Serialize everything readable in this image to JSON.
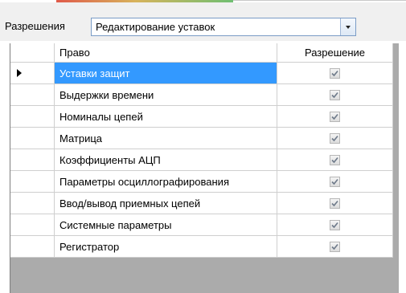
{
  "toolbar": {
    "permissions_label": "Разрешения",
    "combo_value": "Редактирование уставок"
  },
  "grid": {
    "columns": [
      "Право",
      "Разрешение"
    ],
    "rows": [
      {
        "label": "Уставки защит",
        "checked": true,
        "selected": true
      },
      {
        "label": "Выдержки времени",
        "checked": true
      },
      {
        "label": "Номиналы цепей",
        "checked": true
      },
      {
        "label": "Матрица",
        "checked": true
      },
      {
        "label": "Коэффициенты АЦП",
        "checked": true
      },
      {
        "label": "Параметры осциллографирования",
        "checked": true
      },
      {
        "label": "Ввод/вывод приемных цепей",
        "checked": true
      },
      {
        "label": "Системные параметры",
        "checked": true
      },
      {
        "label": "Регистратор",
        "checked": true
      }
    ]
  },
  "colors": {
    "selection": "#3399ff",
    "grid_background": "#ababab"
  }
}
